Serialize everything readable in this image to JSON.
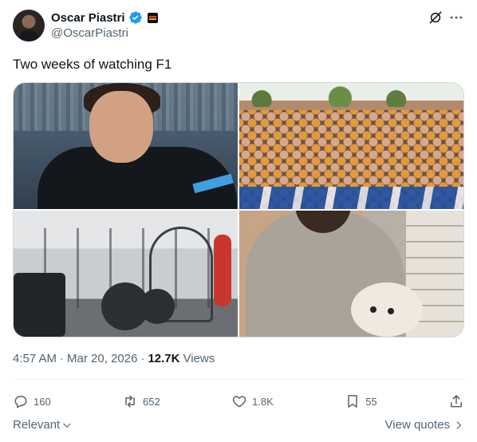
{
  "author": {
    "display_name": "Oscar Piastri",
    "handle": "@OscarPiastri",
    "verified_color": "#1d9bf0"
  },
  "icons": {
    "avatar": "profile-photo",
    "verified": "verified-badge-icon",
    "affiliate": "team-flag-icon",
    "grok": "grok-icon",
    "more": "more-icon",
    "reply": "reply-icon",
    "repost": "repost-icon",
    "like": "heart-icon",
    "bookmark": "bookmark-icon",
    "share": "share-icon",
    "chevron_down": "chevron-down-icon",
    "chevron_right": "chevron-right-icon"
  },
  "tweet": {
    "text": "Two weeks of watching F1",
    "time": "4:57 AM",
    "date": "Mar 20, 2026",
    "views_count": "12.7K",
    "views_label": "Views",
    "separator": "·"
  },
  "media": [
    {
      "description": "driver in team suit"
    },
    {
      "description": "crowd of fans"
    },
    {
      "description": "gym"
    },
    {
      "description": "person with dog"
    }
  ],
  "actions": {
    "replies": "160",
    "reposts": "652",
    "likes": "1.8K",
    "bookmarks": "55"
  },
  "footer": {
    "sort_label": "Relevant",
    "view_quotes": "View quotes"
  }
}
